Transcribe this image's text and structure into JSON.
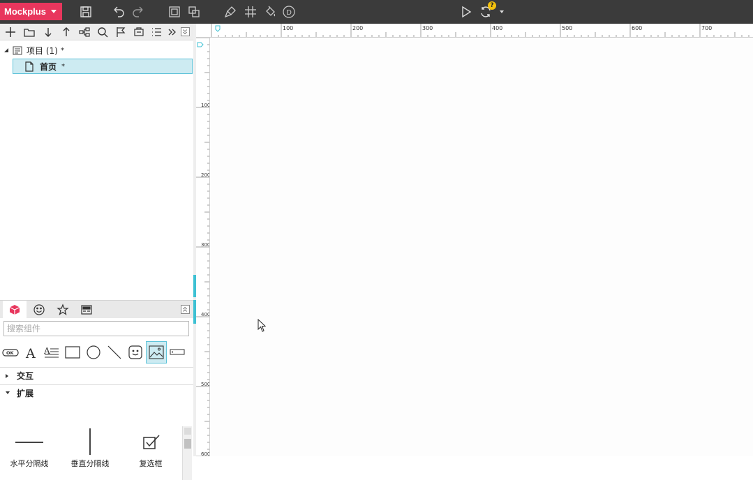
{
  "app": {
    "brand": "Mockplus",
    "accent_color": "#e8365d",
    "toolbar_bg": "#3b3b3b",
    "selection_color": "#cdebf2",
    "toolbar_icons": [
      "save-icon",
      "undo-icon",
      "redo-icon",
      "group-icon",
      "ungroup-icon",
      "format-brush-icon",
      "grid-icon",
      "fill-bucket-icon",
      "d-circle-icon",
      "play-icon",
      "sync-icon",
      "sync-dropdown-icon"
    ]
  },
  "project_tree": {
    "root_label": "项目 (1)",
    "root_marker": "*",
    "pages": [
      {
        "label": "首页",
        "marker": "*",
        "selected": true
      }
    ]
  },
  "components": {
    "search_placeholder": "搜索组件",
    "tabs": [
      "components-tab",
      "icons-tab",
      "favorites-tab",
      "templates-tab"
    ],
    "basic_widgets": [
      "button-widget",
      "text-widget",
      "paragraph-widget",
      "rectangle-widget",
      "circle-widget",
      "line-widget",
      "icon-widget",
      "image-widget",
      "input-widget"
    ],
    "categories": [
      {
        "label": "交互",
        "expanded": false
      },
      {
        "label": "扩展",
        "expanded": true
      }
    ],
    "extension_items": [
      {
        "label": "水平分隔线"
      },
      {
        "label": "垂直分隔线"
      },
      {
        "label": "复选框"
      }
    ]
  },
  "ruler": {
    "top_labels": [
      "100",
      "200",
      "300",
      "400",
      "500",
      "600",
      "700"
    ],
    "left_labels": [
      "100",
      "200",
      "300",
      "400",
      "500",
      "600"
    ]
  }
}
